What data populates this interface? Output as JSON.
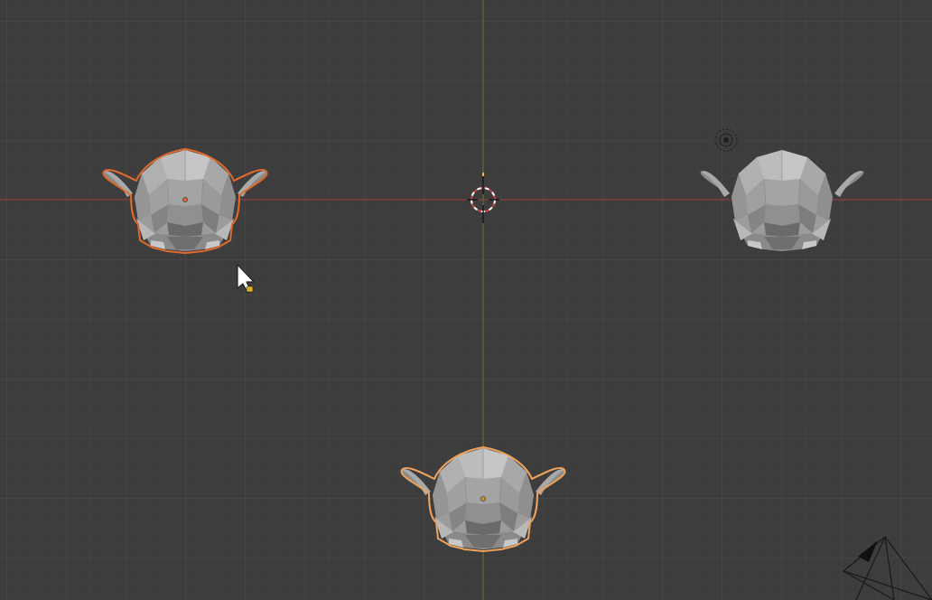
{
  "app": {
    "name": "3D Viewport",
    "view": "front-orthographic"
  },
  "colors": {
    "background": "#3d3d3d",
    "grid_minor": "#474747",
    "grid_major": "#505050",
    "axis_x": "#a43a3a",
    "axis_z": "#5d7a2f",
    "mesh_fill": "#9c9c9c",
    "mesh_light": "#c4c4c4",
    "mesh_dark": "#6e6e6e",
    "outline_active": "#f0a35c",
    "outline_selected": "#e06a2c",
    "origin_dot": "#e08a2a"
  },
  "objects": [
    {
      "id": "monkey-left",
      "state": "selected"
    },
    {
      "id": "monkey-right",
      "state": "unselected"
    },
    {
      "id": "monkey-bottom",
      "state": "active"
    }
  ],
  "scene_items": {
    "cursor_3d": "3d-cursor-icon",
    "light": "light-icon",
    "camera": "camera-icon",
    "mouse": "mouse-pointer-icon"
  }
}
